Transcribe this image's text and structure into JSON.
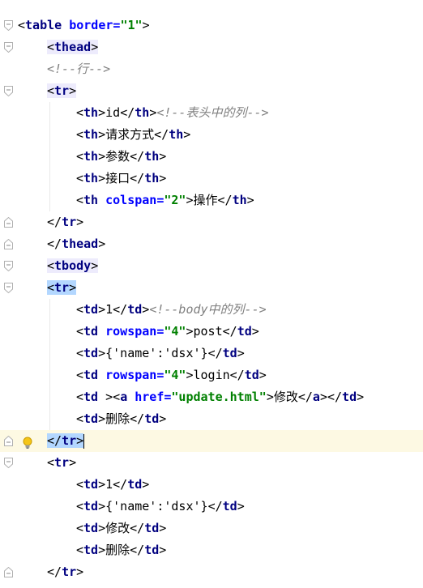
{
  "lines": [
    {
      "fold": "open",
      "indent": 0,
      "segs": [
        [
          "b",
          "<"
        ],
        [
          "t",
          "table"
        ],
        [
          "a",
          " border="
        ],
        [
          "v",
          "\"1\""
        ],
        [
          "b",
          ">"
        ]
      ]
    },
    {
      "fold": "open",
      "indent": 1,
      "segs": [
        [
          "b",
          "<"
        ],
        [
          "t",
          "thead"
        ],
        [
          "b",
          ">"
        ]
      ],
      "hl": true
    },
    {
      "fold": "",
      "indent": 1,
      "segs": [
        [
          "c",
          "<!--行-->"
        ]
      ]
    },
    {
      "fold": "open",
      "indent": 1,
      "segs": [
        [
          "b",
          "<"
        ],
        [
          "t",
          "tr"
        ],
        [
          "b",
          ">"
        ]
      ],
      "hl": true
    },
    {
      "fold": "",
      "indent": 2,
      "segs": [
        [
          "b",
          "<"
        ],
        [
          "t",
          "th"
        ],
        [
          "b",
          ">"
        ],
        [
          "x",
          "id"
        ],
        [
          "b",
          "</"
        ],
        [
          "t",
          "th"
        ],
        [
          "b",
          ">"
        ],
        [
          "c",
          "<!--表头中的列-->"
        ]
      ]
    },
    {
      "fold": "",
      "indent": 2,
      "segs": [
        [
          "b",
          "<"
        ],
        [
          "t",
          "th"
        ],
        [
          "b",
          ">"
        ],
        [
          "x",
          "请求方式"
        ],
        [
          "b",
          "</"
        ],
        [
          "t",
          "th"
        ],
        [
          "b",
          ">"
        ]
      ]
    },
    {
      "fold": "",
      "indent": 2,
      "segs": [
        [
          "b",
          "<"
        ],
        [
          "t",
          "th"
        ],
        [
          "b",
          ">"
        ],
        [
          "x",
          "参数"
        ],
        [
          "b",
          "</"
        ],
        [
          "t",
          "th"
        ],
        [
          "b",
          ">"
        ]
      ]
    },
    {
      "fold": "",
      "indent": 2,
      "segs": [
        [
          "b",
          "<"
        ],
        [
          "t",
          "th"
        ],
        [
          "b",
          ">"
        ],
        [
          "x",
          "接口"
        ],
        [
          "b",
          "</"
        ],
        [
          "t",
          "th"
        ],
        [
          "b",
          ">"
        ]
      ]
    },
    {
      "fold": "",
      "indent": 2,
      "segs": [
        [
          "b",
          "<"
        ],
        [
          "t",
          "th"
        ],
        [
          "a",
          " colspan="
        ],
        [
          "v",
          "\"2\""
        ],
        [
          "b",
          ">"
        ],
        [
          "x",
          "操作"
        ],
        [
          "b",
          "</"
        ],
        [
          "t",
          "th"
        ],
        [
          "b",
          ">"
        ]
      ]
    },
    {
      "fold": "close",
      "indent": 1,
      "segs": [
        [
          "b",
          "</"
        ],
        [
          "t",
          "tr"
        ],
        [
          "b",
          ">"
        ]
      ]
    },
    {
      "fold": "close",
      "indent": 1,
      "segs": [
        [
          "b",
          "</"
        ],
        [
          "t",
          "thead"
        ],
        [
          "b",
          ">"
        ]
      ]
    },
    {
      "fold": "open",
      "indent": 1,
      "segs": [
        [
          "b",
          "<"
        ],
        [
          "t",
          "tbody"
        ],
        [
          "b",
          ">"
        ]
      ],
      "hl": true
    },
    {
      "fold": "open",
      "indent": 1,
      "segs": [
        [
          "b",
          "<"
        ],
        [
          "t",
          "tr"
        ],
        [
          "b",
          ">"
        ]
      ],
      "hl2": true
    },
    {
      "fold": "",
      "indent": 2,
      "segs": [
        [
          "b",
          "<"
        ],
        [
          "t",
          "td"
        ],
        [
          "b",
          ">"
        ],
        [
          "x",
          "1"
        ],
        [
          "b",
          "</"
        ],
        [
          "t",
          "td"
        ],
        [
          "b",
          ">"
        ],
        [
          "c",
          "<!--body中的列-->"
        ]
      ]
    },
    {
      "fold": "",
      "indent": 2,
      "segs": [
        [
          "b",
          "<"
        ],
        [
          "t",
          "td"
        ],
        [
          "a",
          " rowspan="
        ],
        [
          "v",
          "\"4\""
        ],
        [
          "b",
          ">"
        ],
        [
          "x",
          "post"
        ],
        [
          "b",
          "</"
        ],
        [
          "t",
          "td"
        ],
        [
          "b",
          ">"
        ]
      ]
    },
    {
      "fold": "",
      "indent": 2,
      "segs": [
        [
          "b",
          "<"
        ],
        [
          "t",
          "td"
        ],
        [
          "b",
          ">"
        ],
        [
          "x",
          "{'name':'dsx'}"
        ],
        [
          "b",
          "</"
        ],
        [
          "t",
          "td"
        ],
        [
          "b",
          ">"
        ]
      ]
    },
    {
      "fold": "",
      "indent": 2,
      "segs": [
        [
          "b",
          "<"
        ],
        [
          "t",
          "td"
        ],
        [
          "a",
          " rowspan="
        ],
        [
          "v",
          "\"4\""
        ],
        [
          "b",
          ">"
        ],
        [
          "x",
          "login"
        ],
        [
          "b",
          "</"
        ],
        [
          "t",
          "td"
        ],
        [
          "b",
          ">"
        ]
      ]
    },
    {
      "fold": "",
      "indent": 2,
      "segs": [
        [
          "b",
          "<"
        ],
        [
          "t",
          "td"
        ],
        [
          "b",
          " ><"
        ],
        [
          "t",
          "a"
        ],
        [
          "a",
          " href="
        ],
        [
          "v",
          "\"update.html\""
        ],
        [
          "b",
          ">"
        ],
        [
          "x",
          "修改"
        ],
        [
          "b",
          "</"
        ],
        [
          "t",
          "a"
        ],
        [
          "b",
          "></"
        ],
        [
          "t",
          "td"
        ],
        [
          "b",
          ">"
        ]
      ]
    },
    {
      "fold": "",
      "indent": 2,
      "segs": [
        [
          "b",
          "<"
        ],
        [
          "t",
          "td"
        ],
        [
          "b",
          ">"
        ],
        [
          "x",
          "删除"
        ],
        [
          "b",
          "</"
        ],
        [
          "t",
          "td"
        ],
        [
          "b",
          ">"
        ]
      ]
    },
    {
      "fold": "close",
      "indent": 1,
      "segs": [
        [
          "b",
          "</"
        ],
        [
          "t",
          "tr"
        ],
        [
          "b",
          ">"
        ]
      ],
      "hl2": true,
      "current": true,
      "bulb": true,
      "caret": true
    },
    {
      "fold": "open",
      "indent": 1,
      "segs": [
        [
          "b",
          "<"
        ],
        [
          "t",
          "tr"
        ],
        [
          "b",
          ">"
        ]
      ]
    },
    {
      "fold": "",
      "indent": 2,
      "segs": [
        [
          "b",
          "<"
        ],
        [
          "t",
          "td"
        ],
        [
          "b",
          ">"
        ],
        [
          "x",
          "1"
        ],
        [
          "b",
          "</"
        ],
        [
          "t",
          "td"
        ],
        [
          "b",
          ">"
        ]
      ]
    },
    {
      "fold": "",
      "indent": 2,
      "segs": [
        [
          "b",
          "<"
        ],
        [
          "t",
          "td"
        ],
        [
          "b",
          ">"
        ],
        [
          "x",
          "{'name':'dsx'}"
        ],
        [
          "b",
          "</"
        ],
        [
          "t",
          "td"
        ],
        [
          "b",
          ">"
        ]
      ]
    },
    {
      "fold": "",
      "indent": 2,
      "segs": [
        [
          "b",
          "<"
        ],
        [
          "t",
          "td"
        ],
        [
          "b",
          ">"
        ],
        [
          "x",
          "修改"
        ],
        [
          "b",
          "</"
        ],
        [
          "t",
          "td"
        ],
        [
          "b",
          ">"
        ]
      ]
    },
    {
      "fold": "",
      "indent": 2,
      "segs": [
        [
          "b",
          "<"
        ],
        [
          "t",
          "td"
        ],
        [
          "b",
          ">"
        ],
        [
          "x",
          "删除"
        ],
        [
          "b",
          "</"
        ],
        [
          "t",
          "td"
        ],
        [
          "b",
          ">"
        ]
      ]
    },
    {
      "fold": "close",
      "indent": 1,
      "segs": [
        [
          "b",
          "</"
        ],
        [
          "t",
          "tr"
        ],
        [
          "b",
          ">"
        ]
      ]
    }
  ],
  "gutter_icons": {
    "fold_open": "fold-open-icon",
    "fold_close": "fold-close-icon",
    "intention": "lightbulb-icon"
  },
  "colors": {
    "tag": "#000080",
    "attribute": "#0000ff",
    "value": "#008000",
    "comment": "#808080",
    "current_line": "#fdf9e3",
    "matched_tag": "#b3d7ff"
  }
}
